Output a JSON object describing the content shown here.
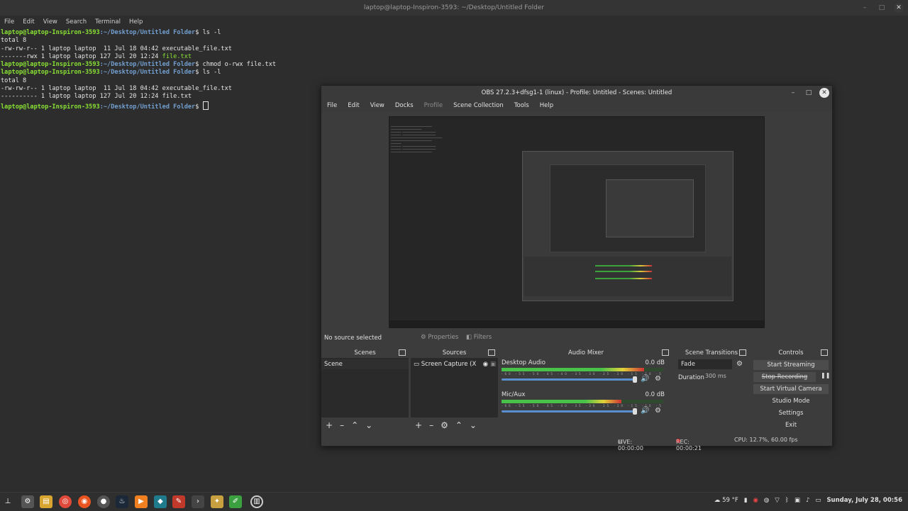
{
  "terminal": {
    "title": "laptop@laptop-Inspiron-3593: ~/Desktop/Untitled Folder",
    "menu": [
      "File",
      "Edit",
      "View",
      "Search",
      "Terminal",
      "Help"
    ],
    "prompt_user": "laptop@laptop-Inspiron-3593",
    "prompt_path": ":~/Desktop/Untitled Folder",
    "lines": {
      "cmd1": "ls -l",
      "out1": "total 8",
      "out2": "-rw-rw-r-- 1 laptop laptop  11 Jul 18 04:42 executable_file.txt",
      "out3a": "-------rwx 1 laptop laptop 127 Jul 20 12:24 ",
      "out3b": "file.txt",
      "cmd2": "chmod o-rwx file.txt",
      "cmd3": "ls -l",
      "out4": "total 8",
      "out5": "-rw-rw-r-- 1 laptop laptop  11 Jul 18 04:42 executable_file.txt",
      "out6": "---------- 1 laptop laptop 127 Jul 20 12:24 file.txt"
    }
  },
  "obs": {
    "title": "OBS 27.2.3+dfsg1-1 (linux) - Profile: Untitled - Scenes: Untitled",
    "menu": [
      "File",
      "Edit",
      "View",
      "Docks",
      "Profile",
      "Scene Collection",
      "Tools",
      "Help"
    ],
    "source_bar": {
      "no_source": "No source selected",
      "properties": "Properties",
      "filters": "Filters"
    },
    "scenes": {
      "header": "Scenes",
      "items": [
        "Scene"
      ]
    },
    "sources": {
      "header": "Sources",
      "items": [
        "Screen Capture (X"
      ]
    },
    "mixer": {
      "header": "Audio Mixer",
      "channels": [
        {
          "name": "Desktop Audio",
          "db": "0.0 dB",
          "level": 0.88
        },
        {
          "name": "Mic/Aux",
          "db": "0.0 dB",
          "level": 0.74
        }
      ]
    },
    "transitions": {
      "header": "Scene Transitions",
      "selected": "Fade",
      "duration_label": "Duration",
      "duration_value": "300 ms"
    },
    "controls": {
      "header": "Controls",
      "buttons": [
        "Start Streaming",
        "Stop Recording",
        "Start Virtual Camera",
        "Studio Mode",
        "Settings",
        "Exit"
      ]
    },
    "status": {
      "live": "LIVE: 00:00:00",
      "rec": "REC: 00:00:21",
      "cpu": "CPU: 12.7%, 60.00 fps"
    }
  },
  "taskbar": {
    "weather": "59 °F",
    "clock": "Sunday, July 28, 00:56"
  }
}
